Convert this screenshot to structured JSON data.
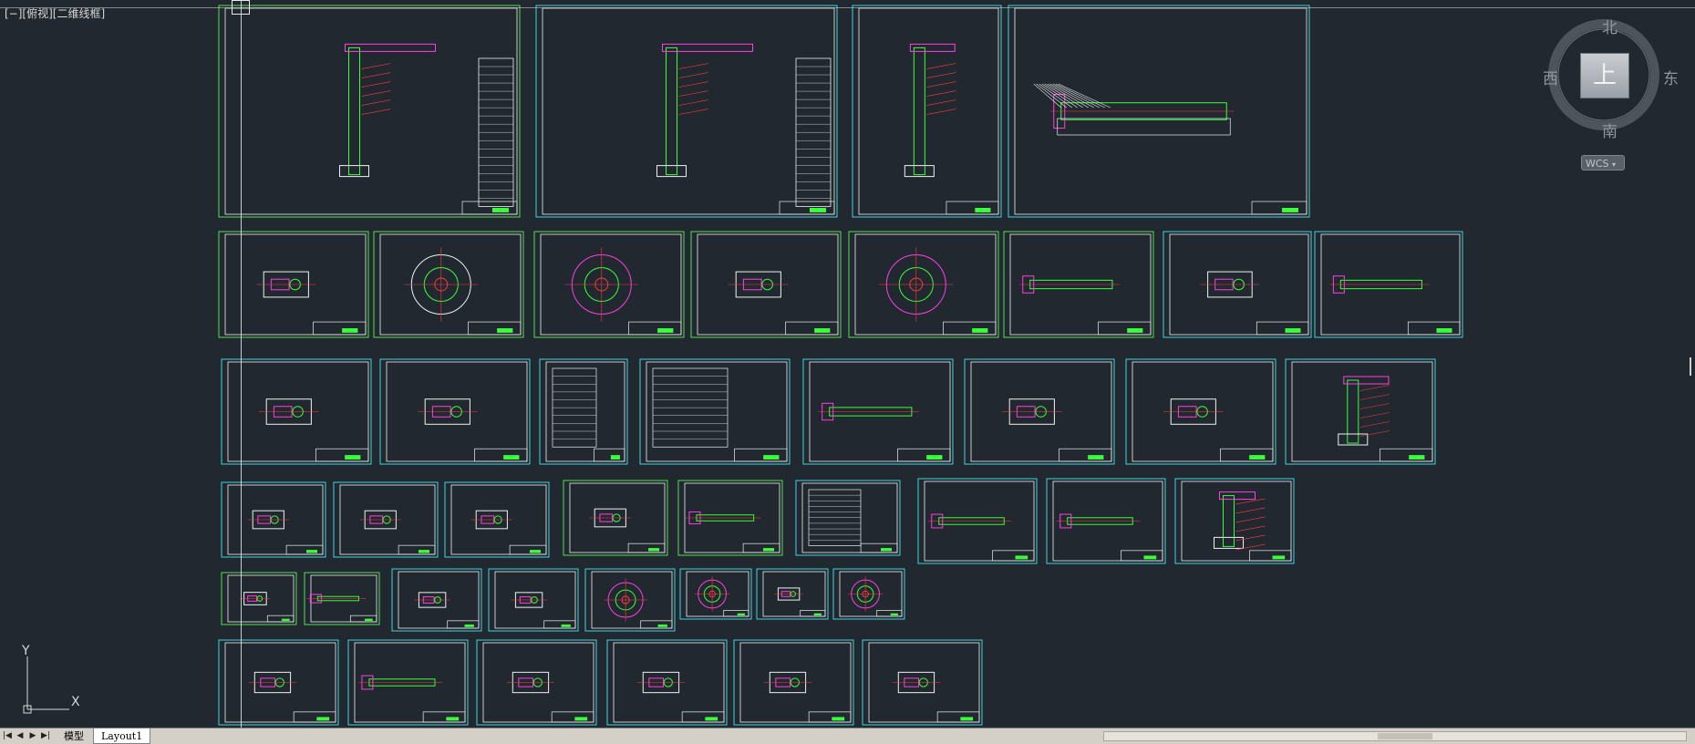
{
  "viewport": {
    "label": "[−][俯视][二维线框]",
    "background": "#212830"
  },
  "viewcube": {
    "north": "北",
    "south": "南",
    "west": "西",
    "east": "东",
    "top_face": "上",
    "wcs_label": "WCS"
  },
  "ucs": {
    "y_label": "Y",
    "x_label": "X"
  },
  "tabs": {
    "nav_buttons": [
      "first-icon",
      "previous-icon",
      "next-icon",
      "last-icon"
    ],
    "model": "模型",
    "layout1": "Layout1"
  },
  "colors": {
    "frame_cyan": "#3fd3e0",
    "frame_green": "#4fe04f",
    "line_white": "#f0f0f0",
    "line_magenta": "#ff3fe0",
    "line_green": "#3aff3a",
    "line_red": "#ff3a3a",
    "line_yellow": "#ffff3a"
  }
}
